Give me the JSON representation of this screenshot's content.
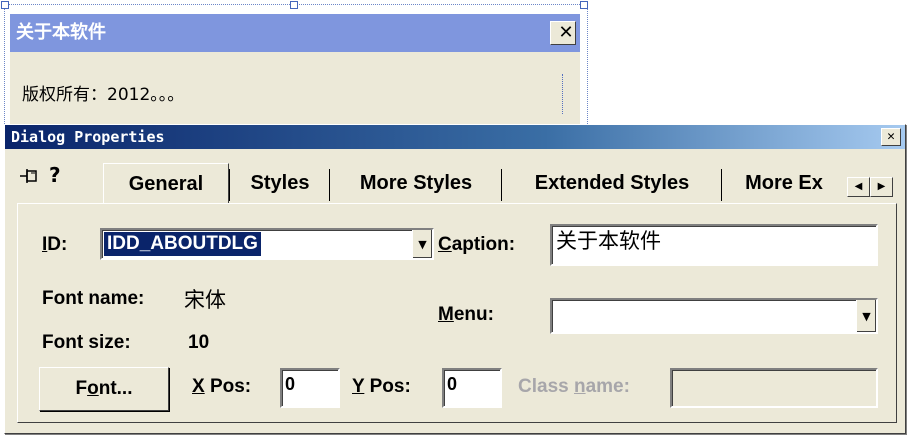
{
  "about_dialog": {
    "title": "关于本软件",
    "close_glyph": "✕",
    "copyright_text": "版权所有：2012。。。"
  },
  "properties": {
    "title": "Dialog Properties",
    "close_glyph": "✕",
    "help_glyph": "?",
    "tabs": [
      {
        "label": "General",
        "active": true
      },
      {
        "label": "Styles",
        "active": false
      },
      {
        "label": "More Styles",
        "active": false
      },
      {
        "label": "Extended Styles",
        "active": false
      },
      {
        "label": "More Ex",
        "active": false
      }
    ],
    "id_label_pre": "",
    "id_label_mn": "I",
    "id_label_post": "D:",
    "id_value": "IDD_ABOUTDLG",
    "caption_label_mn": "C",
    "caption_label_post": "aption:",
    "caption_value": "关于本软件",
    "font_name_label": "Font name:",
    "font_name_value": "宋体",
    "font_size_label": "Font size:",
    "font_size_value": "10",
    "menu_label_mn": "M",
    "menu_label_post": "enu:",
    "menu_value": "",
    "font_button_pre": "F",
    "font_button_mn": "o",
    "font_button_post": "nt...",
    "xpos_label_mn": "X",
    "xpos_label_post": " Pos:",
    "xpos_value": "0",
    "ypos_label_mn": "Y",
    "ypos_label_post": " Pos:",
    "ypos_value": "0",
    "classname_label_pre": "Class ",
    "classname_label_mn": "n",
    "classname_label_post": "ame:",
    "classname_value": ""
  }
}
